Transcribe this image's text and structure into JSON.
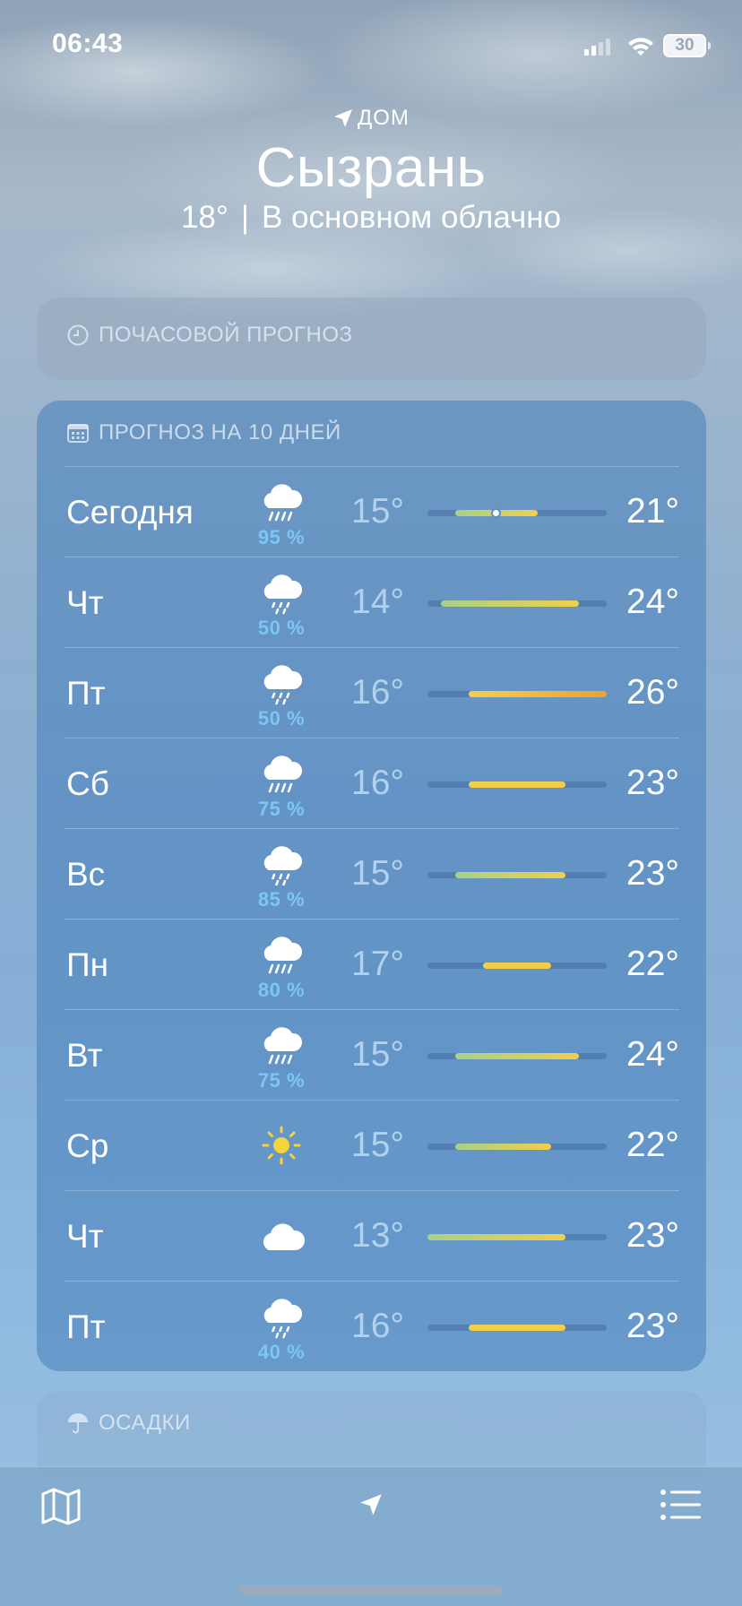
{
  "status_bar": {
    "time": "06:43",
    "battery": "30"
  },
  "header": {
    "location_label": "ДОМ",
    "city": "Сызрань",
    "temperature": "18°",
    "separator": "|",
    "condition": "В основном облачно"
  },
  "hourly": {
    "title": "ПОЧАСОВОЙ ПРОГНОЗ"
  },
  "tenday": {
    "title": "ПРОГНОЗ НА 10 ДНЕЙ",
    "range_min": 13,
    "range_max": 26,
    "days": [
      {
        "day": "Сегодня",
        "icon": "cloud-rain-icon",
        "precip": "95 %",
        "low": "15°",
        "high": "21°",
        "low_value": 15,
        "high_value": 21,
        "current_value": 18
      },
      {
        "day": "Чт",
        "icon": "cloud-drizzle-icon",
        "precip": "50 %",
        "low": "14°",
        "high": "24°",
        "low_value": 14,
        "high_value": 24
      },
      {
        "day": "Пт",
        "icon": "cloud-drizzle-icon",
        "precip": "50 %",
        "low": "16°",
        "high": "26°",
        "low_value": 16,
        "high_value": 26
      },
      {
        "day": "Сб",
        "icon": "cloud-rain-icon",
        "precip": "75 %",
        "low": "16°",
        "high": "23°",
        "low_value": 16,
        "high_value": 23
      },
      {
        "day": "Вс",
        "icon": "cloud-drizzle-icon",
        "precip": "85 %",
        "low": "15°",
        "high": "23°",
        "low_value": 15,
        "high_value": 23
      },
      {
        "day": "Пн",
        "icon": "cloud-rain-icon",
        "precip": "80 %",
        "low": "17°",
        "high": "22°",
        "low_value": 17,
        "high_value": 22
      },
      {
        "day": "Вт",
        "icon": "cloud-rain-icon",
        "precip": "75 %",
        "low": "15°",
        "high": "24°",
        "low_value": 15,
        "high_value": 24
      },
      {
        "day": "Ср",
        "icon": "sun-icon",
        "precip": "",
        "low": "15°",
        "high": "22°",
        "low_value": 15,
        "high_value": 22
      },
      {
        "day": "Чт",
        "icon": "cloud-icon",
        "precip": "",
        "low": "13°",
        "high": "23°",
        "low_value": 13,
        "high_value": 23
      },
      {
        "day": "Пт",
        "icon": "cloud-drizzle-icon",
        "precip": "40 %",
        "low": "16°",
        "high": "23°",
        "low_value": 16,
        "high_value": 23
      }
    ]
  },
  "precipitation": {
    "title": "ОСАДКИ"
  },
  "toolbar": {
    "map_icon": "map-icon",
    "location_icon": "location-arrow-icon",
    "list_icon": "list-icon"
  },
  "colors": {
    "precip_text": "#7cc6f4",
    "bar_cool": "#a8d08a",
    "bar_warm": "#f2cf4a",
    "bar_hot": "#f0a030"
  }
}
